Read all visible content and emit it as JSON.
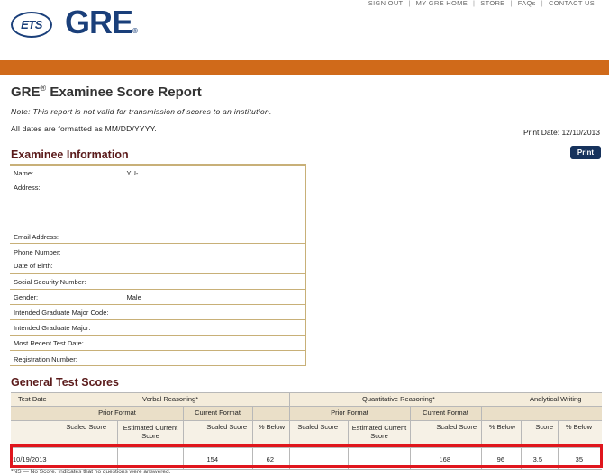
{
  "header": {
    "ets_logo": "ETS",
    "gre_logo": "GRE",
    "nav": [
      "SIGN OUT",
      "MY GRE HOME",
      "STORE",
      "FAQs",
      "CONTACT US"
    ]
  },
  "report": {
    "title": "GRE",
    "title_reg": "®",
    "title_suffix": " Examinee Score Report",
    "note": "Note: This report is not valid for transmission of scores to an institution.",
    "date_note": "All dates are formatted as MM/DD/YYYY.",
    "print_date": "Print Date: 12/10/2013",
    "print_button": "Print"
  },
  "examinee": {
    "heading": "Examinee Information",
    "fields": [
      {
        "label": "Name:",
        "value": "YU-"
      },
      {
        "label": "Address:",
        "value": ""
      },
      {
        "label": "Email Address:",
        "value": ""
      },
      {
        "label": "Phone Number:",
        "value": ""
      },
      {
        "label": "Date of Birth:",
        "value": ""
      },
      {
        "label": "Social Security Number:",
        "value": ""
      },
      {
        "label": "Gender:",
        "value": "Male"
      },
      {
        "label": "Intended Graduate Major Code:",
        "value": ""
      },
      {
        "label": "Intended Graduate Major:",
        "value": ""
      },
      {
        "label": "Most Recent Test Date:",
        "value": ""
      },
      {
        "label": "Registration Number:",
        "value": ""
      }
    ]
  },
  "scores": {
    "heading": "General Test Scores",
    "headers": {
      "test_date": "Test Date",
      "verbal": "Verbal Reasoning*",
      "quant": "Quantitative Reasoning*",
      "writing": "Analytical Writing",
      "prior_format": "Prior Format",
      "current_format": "Current Format",
      "scaled_score": "Scaled Score",
      "estimated_current_score": "Estimated Current Score",
      "pct_below": "% Below",
      "score": "Score"
    },
    "row": {
      "test_date": "10/19/2013",
      "verbal_prior_scaled": "",
      "verbal_prior_estimated": "",
      "verbal_current_scaled": "154",
      "verbal_pct_below": "62",
      "quant_prior_scaled": "",
      "quant_prior_estimated": "",
      "quant_current_scaled": "168",
      "quant_pct_below": "96",
      "writing_score": "3.5",
      "writing_pct_below": "35"
    },
    "footnote": "*NS — No Score. Indicates that no questions were answered."
  }
}
